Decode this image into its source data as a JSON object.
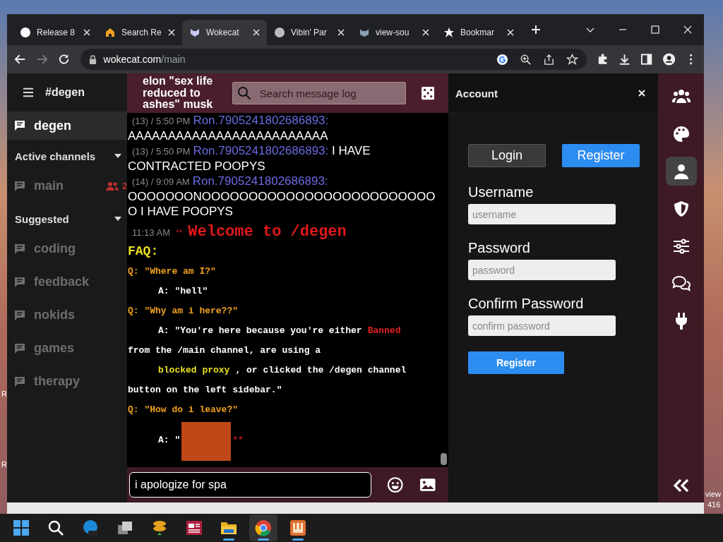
{
  "browser": {
    "tabs": [
      {
        "title": "Release 8",
        "selected": false
      },
      {
        "title": "Search Re",
        "selected": false
      },
      {
        "title": "Wokecat",
        "selected": true
      },
      {
        "title": "Vibin' Par",
        "selected": false
      },
      {
        "title": "view-sou",
        "selected": false
      },
      {
        "title": "Bookmar",
        "selected": false
      }
    ],
    "url_host": "wokecat.com",
    "url_path": "/main"
  },
  "sidebar": {
    "channel_title": "#degen",
    "current": {
      "name": "degen",
      "selected": true
    },
    "sections": [
      {
        "title": "Active channels",
        "expanded": true,
        "items": [
          {
            "name": "main",
            "users": "2"
          }
        ]
      },
      {
        "title": "Suggested",
        "expanded": true,
        "items": [
          {
            "name": "coding"
          },
          {
            "name": "feedback"
          },
          {
            "name": "nokids"
          },
          {
            "name": "games"
          },
          {
            "name": "therapy"
          }
        ]
      }
    ]
  },
  "chat": {
    "topic": "elon \"sex life reduced to ashes\" musk",
    "search": {
      "placeholder": "Search message log"
    },
    "messages": [
      {
        "meta": "(13) / 5:50 PM",
        "user": "Ron.7905241802686893:",
        "text": "AAAAAAAAAAAAAAAAAAAAAAAAA"
      },
      {
        "meta": "(13) / 5:50 PM",
        "user": "Ron.7905241802686893:",
        "text": "I HAVE CONTRACTED POOPYS"
      },
      {
        "meta": "(14) / 9:09 AM",
        "user": "Ron.7905241802686893:",
        "text": "OOOOOOONOOOOOOOOOOOOOOOOOOOOOOOOOO I HAVE POOPYS"
      }
    ],
    "welcome": {
      "time": "11:13 AM",
      "marks": "**",
      "title": "Welcome to /degen"
    },
    "faq": [
      {
        "kind": "heading",
        "indent": false,
        "segments": [
          {
            "kind": "text",
            "text": "FAQ:",
            "color": "#e8e020"
          }
        ]
      },
      {
        "kind": "q",
        "indent": false,
        "segments": [
          {
            "kind": "text",
            "text": "Q: \"Where am I?\"",
            "color": "#f0a020"
          }
        ]
      },
      {
        "kind": "a",
        "indent": true,
        "segments": [
          {
            "kind": "text",
            "text": "A: \"hell\"",
            "color": "#ffffff"
          }
        ]
      },
      {
        "kind": "q",
        "indent": false,
        "segments": [
          {
            "kind": "text",
            "text": "Q: \"Why am i here??\"",
            "color": "#f0a020"
          }
        ]
      },
      {
        "kind": "a",
        "indent": true,
        "segments": [
          {
            "kind": "text",
            "text": "A: \"You're here because you're either",
            "color": "#ffffff"
          },
          {
            "kind": "text",
            "text": "Banned",
            "color": "#e02020"
          }
        ]
      },
      {
        "kind": "a",
        "indent": false,
        "segments": [
          {
            "kind": "text",
            "text": "from the /main channel, are using a",
            "color": "#ffffff"
          }
        ]
      },
      {
        "kind": "a",
        "indent": true,
        "segments": [
          {
            "kind": "text",
            "text": "blocked proxy",
            "color": "#e8e020"
          },
          {
            "kind": "text",
            "text": ", or clicked the /degen channel",
            "color": "#ffffff"
          }
        ]
      },
      {
        "kind": "a",
        "indent": false,
        "segments": [
          {
            "kind": "text",
            "text": "button on the left sidebar.\"",
            "color": "#ffffff"
          }
        ]
      },
      {
        "kind": "q",
        "indent": false,
        "segments": [
          {
            "kind": "text",
            "text": "Q: \"How do i leave?\"",
            "color": "#f0a020"
          }
        ]
      },
      {
        "kind": "a",
        "indent": true,
        "segments": [
          {
            "kind": "text",
            "text": "A: \"",
            "color": "#ffffff"
          },
          {
            "kind": "image"
          },
          {
            "kind": "text",
            "text": "**",
            "color": "#c01818"
          }
        ]
      }
    ],
    "composer": {
      "value": "i apologize for spa"
    }
  },
  "account": {
    "title": "Account",
    "tabs": [
      {
        "label": "Login",
        "selected": false
      },
      {
        "label": "Register",
        "selected": true
      }
    ],
    "fields": [
      {
        "label": "Username",
        "placeholder": "username"
      },
      {
        "label": "Password",
        "placeholder": "password"
      },
      {
        "label": "Confirm Password",
        "placeholder": "confirm password"
      }
    ],
    "submit": "Register"
  },
  "rail": [
    {
      "selected": false
    },
    {
      "selected": false
    },
    {
      "selected": true
    },
    {
      "selected": false
    },
    {
      "selected": false
    },
    {
      "selected": false
    },
    {
      "selected": false
    }
  ],
  "taskbar": [
    {
      "running": false,
      "selected": false
    },
    {
      "running": false,
      "selected": false
    },
    {
      "running": false,
      "selected": false
    },
    {
      "running": false,
      "selected": false
    },
    {
      "running": false,
      "selected": false
    },
    {
      "running": false,
      "selected": false
    },
    {
      "running": true,
      "selected": false
    },
    {
      "running": true,
      "selected": true
    },
    {
      "running": true,
      "selected": false
    }
  ],
  "desktop_fragments": [
    "R",
    "R",
    "view",
    "416"
  ]
}
